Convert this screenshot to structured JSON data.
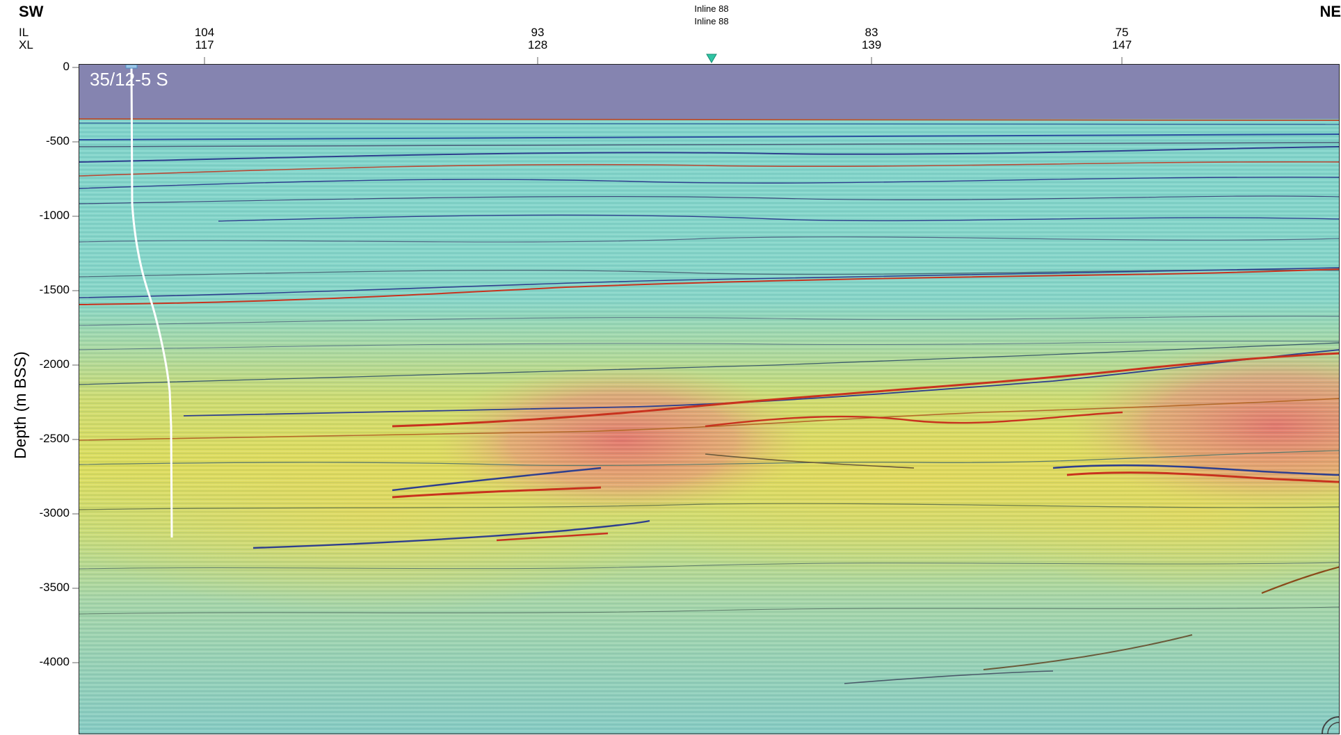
{
  "header": {
    "left_direction": "SW",
    "right_direction": "NE",
    "il_key": "IL",
    "xl_key": "XL",
    "inline_marker": {
      "line1": "Inline 88",
      "line2": "Inline 88",
      "color": "#2fc4a4"
    },
    "top_axis": [
      {
        "il": "104",
        "xl": "117"
      },
      {
        "il": "93",
        "xl": "128"
      },
      {
        "il": "83",
        "xl": "139"
      },
      {
        "il": "75",
        "xl": "147"
      }
    ]
  },
  "y_axis": {
    "title": "Depth (m BSS)",
    "ticks": [
      "0",
      "-500",
      "-1000",
      "-1500",
      "-2000",
      "-2500",
      "-3000",
      "-3500",
      "-4000"
    ]
  },
  "section": {
    "well_name": "35/12-5 S",
    "colors": {
      "water": "#8584b0",
      "background": "#86d6c8",
      "warm_zone": "#d9dc52",
      "hot_zone": "#e97a7a",
      "reflector_red": "#c8321e",
      "reflector_blue": "#2d3f9a",
      "well_path": "#ffffff"
    }
  }
}
